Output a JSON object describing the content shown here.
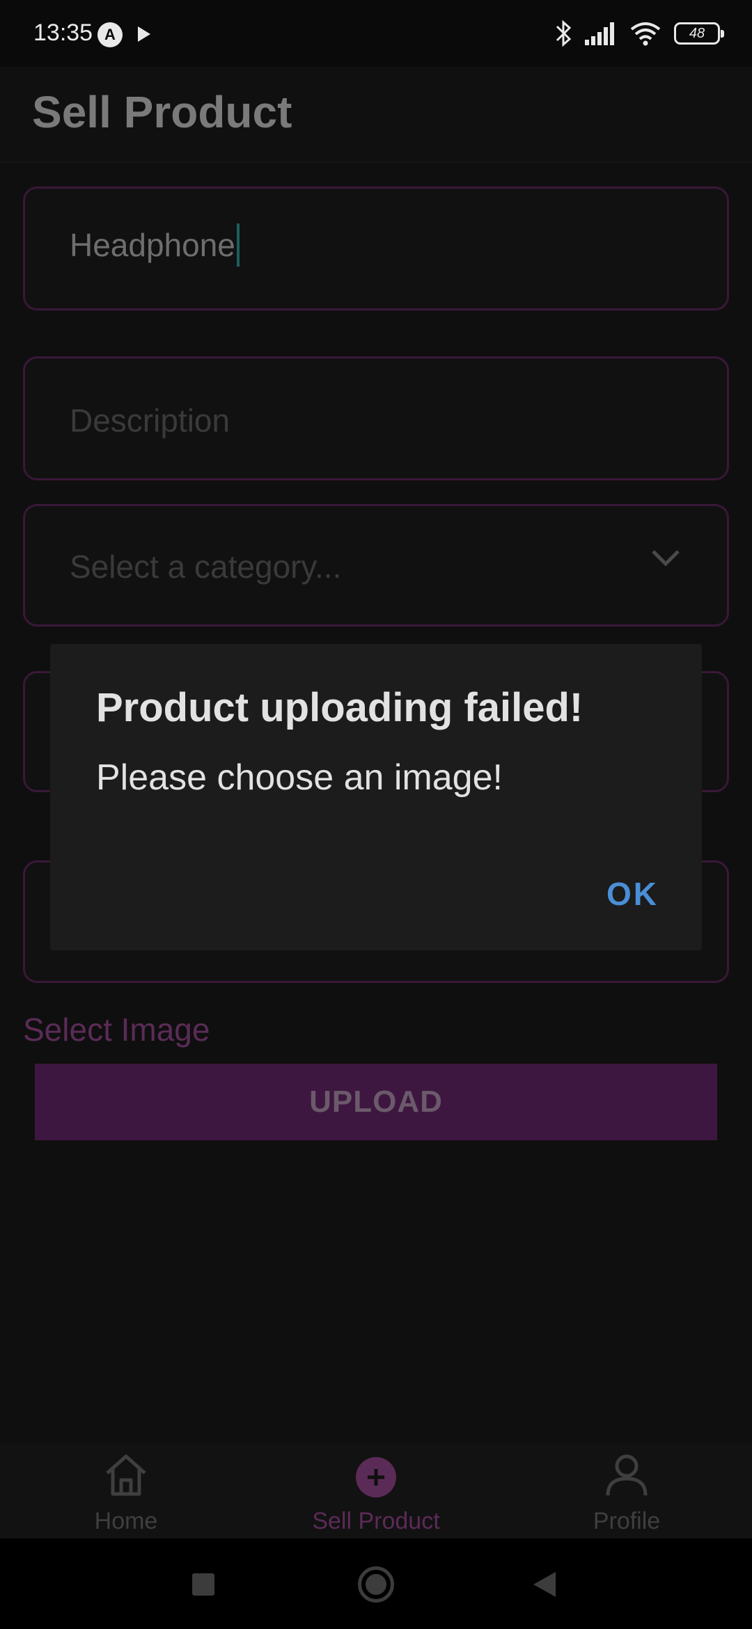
{
  "status_bar": {
    "time": "13:35",
    "battery": "48",
    "icons": [
      "app-a-icon",
      "play-icon",
      "bluetooth-icon",
      "signal-icon",
      "wifi-icon",
      "battery-icon"
    ]
  },
  "header": {
    "title": "Sell Product"
  },
  "form": {
    "name": {
      "value": "Headphone"
    },
    "description": {
      "placeholder": "Description"
    },
    "category": {
      "placeholder": "Select a category..."
    },
    "select_image_label": "Select Image",
    "upload_label": "UPLOAD"
  },
  "dialog": {
    "title": "Product uploading failed!",
    "message": "Please choose an image!",
    "ok_label": "OK"
  },
  "bottom_nav": {
    "items": [
      {
        "label": "Home",
        "icon": "home-icon",
        "active": false
      },
      {
        "label": "Sell Product",
        "icon": "add-circle-icon",
        "active": true
      },
      {
        "label": "Profile",
        "icon": "profile-icon",
        "active": false
      }
    ]
  },
  "colors": {
    "accent": "#5b2b57",
    "upload_button": "#3e1740",
    "dialog_action": "#4a8fd6",
    "field_border": "#3a1838"
  }
}
